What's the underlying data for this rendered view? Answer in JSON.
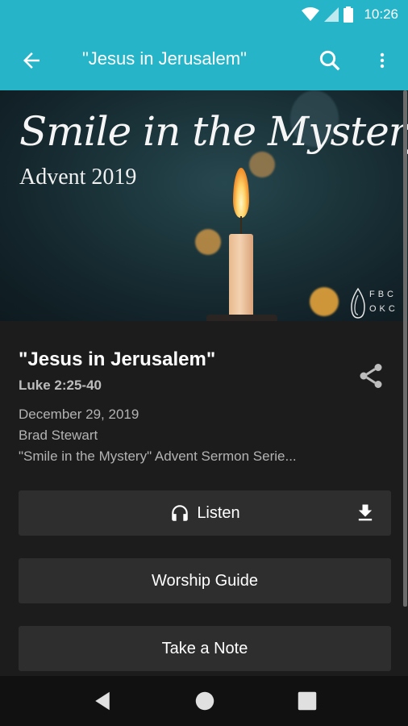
{
  "status_bar": {
    "time": "10:26"
  },
  "app_bar": {
    "title": "\"Jesus in Jerusalem\""
  },
  "hero": {
    "script_title": "Smile in the Mystery",
    "subtitle": "Advent 2019",
    "logo_text": "FBC OKC"
  },
  "sermon": {
    "title": "\"Jesus in Jerusalem\"",
    "scripture": "Luke 2:25-40",
    "date": "December 29, 2019",
    "speaker": "Brad Stewart",
    "series": "\"Smile in the Mystery\" Advent Sermon Serie..."
  },
  "buttons": {
    "listen": "Listen",
    "worship_guide": "Worship Guide",
    "take_note": "Take a Note"
  },
  "colors": {
    "app_bar": "#26b4c9",
    "background": "#1c1c1c",
    "button": "#2e2e2e"
  }
}
